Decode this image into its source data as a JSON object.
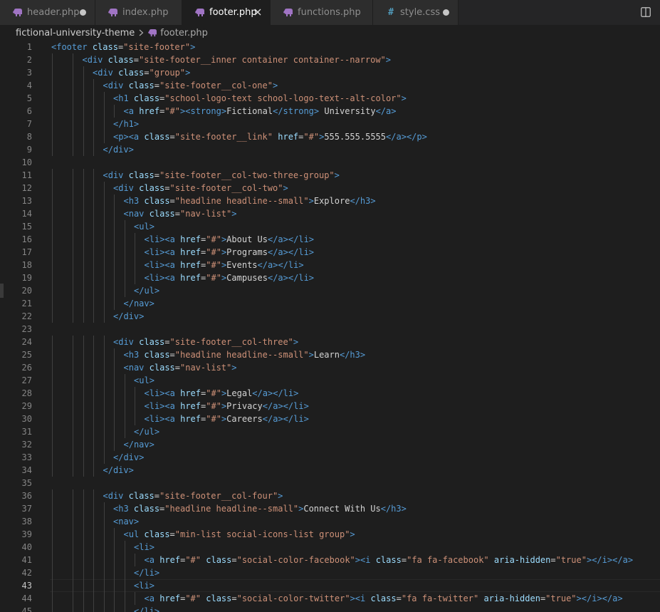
{
  "tabs": [
    {
      "label": "header.php",
      "icon": "php-elephant-icon",
      "state": "modified"
    },
    {
      "label": "index.php",
      "icon": "php-elephant-icon",
      "state": "normal"
    },
    {
      "label": "footer.php",
      "icon": "php-elephant-icon",
      "state": "active"
    },
    {
      "label": "functions.php",
      "icon": "php-elephant-icon",
      "state": "normal"
    },
    {
      "label": "style.css",
      "icon": "css-hash-icon",
      "state": "modified"
    }
  ],
  "breadcrumb": {
    "folder": "fictional-university-theme",
    "file": "footer.php"
  },
  "editor": {
    "current_line": 43,
    "colors": {
      "tag": "#569cd6",
      "attr": "#9cdcfe",
      "string": "#ce9178",
      "text": "#d4d4d4"
    },
    "lines": [
      {
        "n": "1",
        "indent": 0,
        "code": "<footer class=\"site-footer\">"
      },
      {
        "n": "2",
        "indent": 3,
        "code": "<div class=\"site-footer__inner container container--narrow\">"
      },
      {
        "n": "3",
        "indent": 4,
        "code": "<div class=\"group\">"
      },
      {
        "n": "4",
        "indent": 5,
        "code": "<div class=\"site-footer__col-one\">"
      },
      {
        "n": "5",
        "indent": 6,
        "code": "<h1 class=\"school-logo-text school-logo-text--alt-color\">"
      },
      {
        "n": "6",
        "indent": 7,
        "code": "<a href=\"#\"><strong>Fictional</strong> University</a>"
      },
      {
        "n": "7",
        "indent": 6,
        "code": "</h1>"
      },
      {
        "n": "8",
        "indent": 6,
        "code": "<p><a class=\"site-footer__link\" href=\"#\">555.555.5555</a></p>"
      },
      {
        "n": "9",
        "indent": 5,
        "code": "</div>"
      },
      {
        "n": "10",
        "indent": 0,
        "code": ""
      },
      {
        "n": "11",
        "indent": 5,
        "code": "<div class=\"site-footer__col-two-three-group\">"
      },
      {
        "n": "12",
        "indent": 6,
        "code": "<div class=\"site-footer__col-two\">"
      },
      {
        "n": "13",
        "indent": 7,
        "code": "<h3 class=\"headline headline--small\">Explore</h3>"
      },
      {
        "n": "14",
        "indent": 7,
        "code": "<nav class=\"nav-list\">"
      },
      {
        "n": "15",
        "indent": 8,
        "code": "<ul>"
      },
      {
        "n": "16",
        "indent": 9,
        "code": "<li><a href=\"#\">About Us</a></li>"
      },
      {
        "n": "17",
        "indent": 9,
        "code": "<li><a href=\"#\">Programs</a></li>"
      },
      {
        "n": "18",
        "indent": 9,
        "code": "<li><a href=\"#\">Events</a></li>"
      },
      {
        "n": "19",
        "indent": 9,
        "code": "<li><a href=\"#\">Campuses</a></li>"
      },
      {
        "n": "20",
        "indent": 8,
        "code": "</ul>"
      },
      {
        "n": "21",
        "indent": 7,
        "code": "</nav>"
      },
      {
        "n": "22",
        "indent": 6,
        "code": "</div>"
      },
      {
        "n": "23",
        "indent": 0,
        "code": ""
      },
      {
        "n": "24",
        "indent": 6,
        "code": "<div class=\"site-footer__col-three\">"
      },
      {
        "n": "25",
        "indent": 7,
        "code": "<h3 class=\"headline headline--small\">Learn</h3>"
      },
      {
        "n": "26",
        "indent": 7,
        "code": "<nav class=\"nav-list\">"
      },
      {
        "n": "27",
        "indent": 8,
        "code": "<ul>"
      },
      {
        "n": "28",
        "indent": 9,
        "code": "<li><a href=\"#\">Legal</a></li>"
      },
      {
        "n": "29",
        "indent": 9,
        "code": "<li><a href=\"#\">Privacy</a></li>"
      },
      {
        "n": "30",
        "indent": 9,
        "code": "<li><a href=\"#\">Careers</a></li>"
      },
      {
        "n": "31",
        "indent": 8,
        "code": "</ul>"
      },
      {
        "n": "32",
        "indent": 7,
        "code": "</nav>"
      },
      {
        "n": "33",
        "indent": 6,
        "code": "</div>"
      },
      {
        "n": "34",
        "indent": 5,
        "code": "</div>"
      },
      {
        "n": "35",
        "indent": 0,
        "code": ""
      },
      {
        "n": "36",
        "indent": 5,
        "code": "<div class=\"site-footer__col-four\">"
      },
      {
        "n": "37",
        "indent": 6,
        "code": "<h3 class=\"headline headline--small\">Connect With Us</h3>"
      },
      {
        "n": "38",
        "indent": 6,
        "code": "<nav>"
      },
      {
        "n": "39",
        "indent": 7,
        "code": "<ul class=\"min-list social-icons-list group\">"
      },
      {
        "n": "40",
        "indent": 8,
        "code": "<li>"
      },
      {
        "n": "41",
        "indent": 9,
        "code": "<a href=\"#\" class=\"social-color-facebook\"><i class=\"fa fa-facebook\" aria-hidden=\"true\"></i></a>"
      },
      {
        "n": "42",
        "indent": 8,
        "code": "</li>"
      },
      {
        "n": "43",
        "indent": 8,
        "code": "<li>"
      },
      {
        "n": "44",
        "indent": 9,
        "code": "<a href=\"#\" class=\"social-color-twitter\"><i class=\"fa fa-twitter\" aria-hidden=\"true\"></i></a>"
      },
      {
        "n": "45",
        "indent": 8,
        "code": "</li>"
      }
    ]
  }
}
